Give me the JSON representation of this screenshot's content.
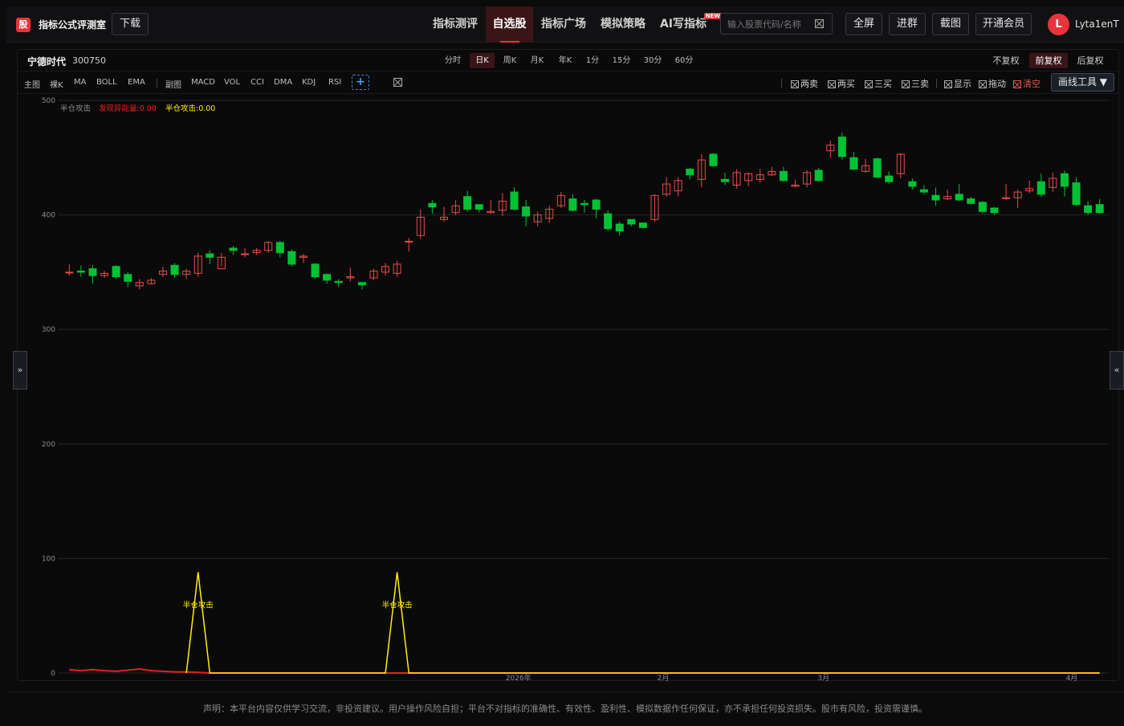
{
  "header": {
    "logo_char": "股",
    "brand": "指标公式评测室",
    "download": "下载",
    "nav": [
      {
        "label": "指标测评",
        "active": false
      },
      {
        "label": "自选股",
        "active": true
      },
      {
        "label": "指标广场",
        "active": false
      },
      {
        "label": "模拟策略",
        "active": false
      },
      {
        "label": "AI写指标",
        "active": false,
        "badge": "NEW"
      }
    ],
    "search_placeholder": "输入股票代码/名称",
    "fullscreen": "全屏",
    "join_group": "进群",
    "screenshot": "截图",
    "membership": "开通会员",
    "avatar_letter": "L",
    "username": "Lyta1enT"
  },
  "stock": {
    "name": "宁德时代",
    "code": "300750"
  },
  "periods": [
    "分时",
    "日K",
    "周K",
    "月K",
    "年K",
    "1分",
    "15分",
    "30分",
    "60分"
  ],
  "active_period": "日K",
  "adjust": [
    "不复权",
    "前复权",
    "后复权"
  ],
  "active_adjust": "前复权",
  "indicators": {
    "main_label": "主图",
    "main": [
      "裸K",
      "MA",
      "BOLL",
      "EMA"
    ],
    "sub_label": "副图",
    "sub": [
      "MACD",
      "VOL",
      "CCI",
      "DMA",
      "KDJ",
      "RSI"
    ],
    "add": "+"
  },
  "tools": [
    {
      "label": "两卖",
      "color": "normal"
    },
    {
      "label": "两买",
      "color": "normal"
    },
    {
      "label": "三买",
      "color": "normal"
    },
    {
      "label": "三卖",
      "color": "normal"
    },
    {
      "label": "显示",
      "color": "normal"
    },
    {
      "label": "拖动",
      "color": "normal"
    },
    {
      "label": "清空",
      "color": "red"
    }
  ],
  "draw_tools": "画线工具 ▼",
  "side_left": "»",
  "side_right": "«",
  "legend": {
    "name": "半仓攻击",
    "item1": "发现异能量:0.00",
    "item2": "半仓攻击:0.00"
  },
  "colors": {
    "up": "#e84a4a",
    "down": "#00c234",
    "yellow": "#ffee00",
    "red_line": "#e81f1f",
    "accent": "#e8343b"
  },
  "chart_data": {
    "type": "candlestick",
    "ylim": [
      0,
      500
    ],
    "yticks": [
      0,
      100,
      200,
      300,
      400,
      500
    ],
    "xticks": [
      "2026年",
      "2月",
      "3月",
      "4月"
    ],
    "candles": [
      [
        350,
        350,
        357,
        347
      ],
      [
        351,
        350,
        356,
        346
      ],
      [
        353,
        347,
        356,
        340
      ],
      [
        347,
        349,
        351,
        345
      ],
      [
        355,
        346,
        356,
        344
      ],
      [
        348,
        342,
        350,
        337
      ],
      [
        338,
        341,
        344,
        335
      ],
      [
        340,
        343,
        345,
        339
      ],
      [
        348,
        351,
        355,
        346
      ],
      [
        356,
        348,
        358,
        345
      ],
      [
        348,
        351,
        353,
        344
      ],
      [
        349,
        364,
        367,
        346
      ],
      [
        366,
        363,
        369,
        357
      ],
      [
        353,
        363,
        367,
        355
      ],
      [
        371,
        369,
        373,
        365
      ],
      [
        366,
        366,
        371,
        363
      ],
      [
        367,
        369,
        371,
        365
      ],
      [
        369,
        376,
        377,
        367
      ],
      [
        376,
        367,
        377,
        363
      ],
      [
        368,
        357,
        370,
        355
      ],
      [
        363,
        364,
        366,
        358
      ],
      [
        357,
        346,
        358,
        344
      ],
      [
        348,
        343,
        349,
        340
      ],
      [
        342,
        341,
        344,
        337
      ],
      [
        345,
        346,
        354,
        342
      ],
      [
        341,
        339,
        341,
        335
      ],
      [
        345,
        351,
        353,
        343
      ],
      [
        350,
        355,
        358,
        347
      ],
      [
        349,
        357,
        360,
        346
      ],
      [
        377,
        377,
        380,
        368
      ],
      [
        382,
        398,
        405,
        379
      ],
      [
        410,
        407,
        413,
        401
      ],
      [
        396,
        398,
        407,
        394
      ],
      [
        402,
        408,
        413,
        400
      ],
      [
        416,
        405,
        421,
        403
      ],
      [
        409,
        405,
        407,
        402
      ],
      [
        402,
        403,
        413,
        401
      ],
      [
        404,
        412,
        419,
        399
      ],
      [
        420,
        405,
        424,
        404
      ],
      [
        407,
        399,
        413,
        390
      ],
      [
        394,
        400,
        403,
        390
      ],
      [
        397,
        405,
        408,
        393
      ],
      [
        408,
        417,
        420,
        406
      ],
      [
        414,
        404,
        418,
        403
      ],
      [
        410,
        409,
        413,
        402
      ],
      [
        413,
        405,
        414,
        397
      ],
      [
        401,
        388,
        404,
        386
      ],
      [
        392,
        386,
        394,
        382
      ],
      [
        396,
        392,
        396,
        390
      ],
      [
        393,
        389,
        393,
        388
      ],
      [
        396,
        417,
        418,
        394
      ],
      [
        418,
        427,
        433,
        416
      ],
      [
        421,
        430,
        433,
        416
      ],
      [
        440,
        435,
        441,
        431
      ],
      [
        431,
        448,
        453,
        424
      ],
      [
        453,
        443,
        454,
        442
      ],
      [
        431,
        429,
        437,
        426
      ],
      [
        426,
        437,
        440,
        423
      ],
      [
        430,
        436,
        437,
        425
      ],
      [
        431,
        435,
        440,
        428
      ],
      [
        435,
        438,
        442,
        434
      ],
      [
        438,
        430,
        442,
        429
      ],
      [
        425,
        426,
        431,
        424
      ],
      [
        427,
        437,
        439,
        424
      ],
      [
        439,
        430,
        441,
        429
      ],
      [
        456,
        461,
        465,
        450
      ],
      [
        468,
        451,
        472,
        448
      ],
      [
        450,
        440,
        455,
        439
      ],
      [
        438,
        443,
        449,
        437
      ],
      [
        449,
        433,
        450,
        432
      ],
      [
        434,
        429,
        438,
        427
      ],
      [
        436,
        453,
        454,
        432
      ],
      [
        429,
        425,
        432,
        422
      ],
      [
        422,
        420,
        426,
        418
      ],
      [
        417,
        413,
        424,
        408
      ],
      [
        414,
        416,
        422,
        413
      ],
      [
        418,
        413,
        427,
        412
      ],
      [
        414,
        410,
        416,
        409
      ],
      [
        411,
        403,
        412,
        401
      ],
      [
        406,
        402,
        407,
        400
      ],
      [
        415,
        415,
        427,
        413
      ],
      [
        415,
        420,
        422,
        406
      ],
      [
        421,
        423,
        430,
        419
      ],
      [
        429,
        418,
        436,
        416
      ],
      [
        424,
        432,
        437,
        420
      ],
      [
        436,
        425,
        439,
        416
      ],
      [
        428,
        409,
        433,
        408
      ],
      [
        408,
        402,
        412,
        400
      ],
      [
        409,
        402,
        414,
        401
      ]
    ],
    "sub_ylim": [
      0,
      100
    ],
    "sub_red": [
      3,
      2,
      3,
      2,
      1.5,
      2.5,
      3.5,
      2,
      1.5,
      1,
      1,
      0.5,
      0,
      0,
      0,
      0,
      0,
      0,
      0,
      0,
      0,
      0,
      0,
      0,
      0,
      0,
      0,
      0,
      0,
      0,
      0,
      0,
      0,
      0,
      0,
      0,
      0,
      0,
      0,
      0,
      0,
      0,
      0,
      0,
      0,
      0,
      0,
      0,
      0,
      0,
      0,
      0,
      0,
      0,
      0,
      0,
      0,
      0,
      0,
      0,
      0,
      0,
      0,
      0,
      0,
      0,
      0,
      0,
      0,
      0,
      0,
      0,
      0,
      0,
      0,
      0,
      0,
      0,
      0,
      0,
      0,
      0,
      0,
      0,
      0,
      0,
      0,
      0,
      0
    ],
    "sub_yellow_peaks": [
      11,
      28
    ],
    "sub_yellow_peak_value": 88,
    "peak_label": "半仓攻击"
  },
  "disclaimer": "声明：本平台内容仅供学习交流，非投资建议。用户操作风险自担；平台不对指标的准确性、有效性、盈利性、模拟数据作任何保证，亦不承担任何投资损失。股市有风险，投资需谨慎。"
}
